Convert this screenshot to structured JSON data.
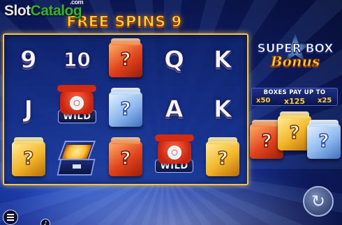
{
  "watermark": {
    "part1": "Slot",
    "part2": "Catalog",
    "suffix": ".com"
  },
  "header": {
    "free_spins_label": "FREE SPINS",
    "free_spins_count": "9"
  },
  "reels": [
    [
      {
        "type": "card",
        "text": "9"
      },
      {
        "type": "card",
        "text": "J"
      },
      {
        "type": "box",
        "color": "gold",
        "text": "?"
      }
    ],
    [
      {
        "type": "card",
        "text": "10"
      },
      {
        "type": "wild",
        "text": "WILD"
      },
      {
        "type": "open-box"
      }
    ],
    [
      {
        "type": "box",
        "color": "red",
        "text": "?"
      },
      {
        "type": "box",
        "color": "blue",
        "text": "?"
      },
      {
        "type": "box",
        "color": "red",
        "text": "?"
      }
    ],
    [
      {
        "type": "card",
        "text": "Q"
      },
      {
        "type": "card",
        "text": "A"
      },
      {
        "type": "wild",
        "text": "WILD"
      }
    ],
    [
      {
        "type": "card",
        "text": "K"
      },
      {
        "type": "card",
        "text": "K"
      },
      {
        "type": "box",
        "color": "gold",
        "text": "?"
      }
    ]
  ],
  "bonus": {
    "line1": "SUPER BOX",
    "line2": "Bonus",
    "pay_title": "BOXES PAY UP TO",
    "pay_values": [
      "x50",
      "x125",
      "x25"
    ]
  },
  "side_boxes": [
    {
      "color": "red",
      "text": "?"
    },
    {
      "color": "gold",
      "text": "?"
    },
    {
      "color": "blue",
      "text": "?"
    }
  ],
  "controls": {
    "spin_icon": "refresh-icon",
    "menu_icon": "menu-icon",
    "sound_icon": "sound-icon"
  }
}
